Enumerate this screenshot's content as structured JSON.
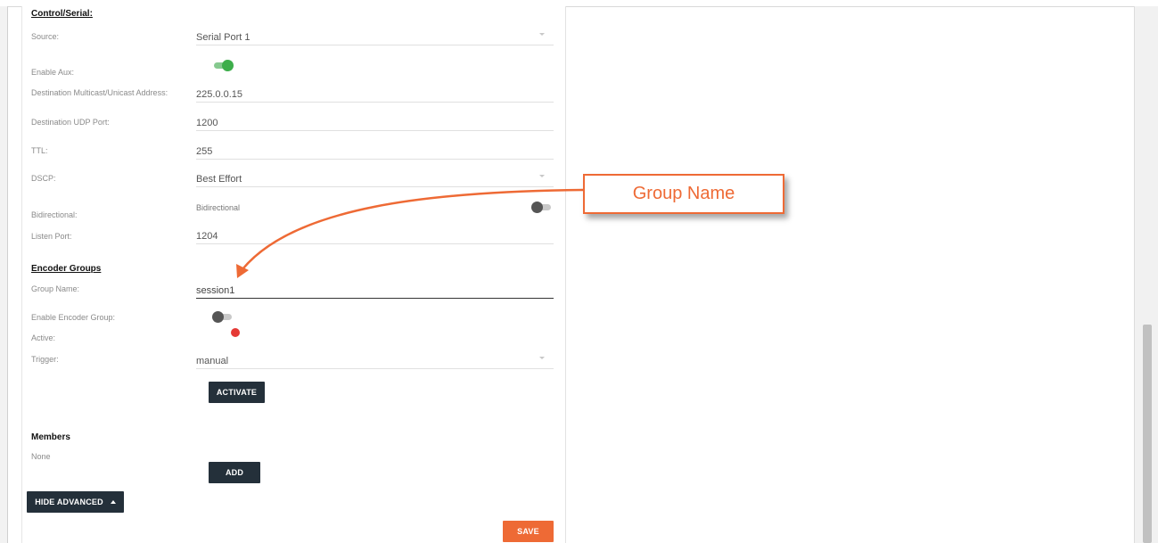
{
  "control_serial": {
    "title": "Control/Serial:",
    "source": {
      "label": "Source:",
      "value": "Serial Port 1"
    },
    "enable_aux": {
      "label": "Enable Aux:",
      "on": true
    },
    "destination_address": {
      "label": "Destination Multicast/Unicast Address:",
      "value": "225.0.0.15"
    },
    "destination_port": {
      "label": "Destination UDP Port:",
      "value": "1200"
    },
    "ttl": {
      "label": "TTL:",
      "value": "255"
    },
    "dscp": {
      "label": "DSCP:",
      "value": "Best Effort"
    },
    "bidirectional": {
      "label": "Bidirectional:",
      "toggle_label": "Bidirectional",
      "on": false
    },
    "listen_port": {
      "label": "Listen Port:",
      "value": "1204"
    }
  },
  "encoder_groups": {
    "title": "Encoder Groups",
    "group_name": {
      "label": "Group Name:",
      "value": "session1"
    },
    "enable_encoder_group": {
      "label": "Enable Encoder Group:",
      "on": false
    },
    "active": {
      "label": "Active:",
      "status_color": "#e53935"
    },
    "trigger": {
      "label": "Trigger:",
      "value": "manual"
    },
    "activate_label": "ACTIVATE"
  },
  "members": {
    "title": "Members",
    "value": "None",
    "add_label": "ADD"
  },
  "hide_advanced_label": "HIDE ADVANCED",
  "save_label": "SAVE",
  "annotation": {
    "text": "Group Name",
    "color": "#ee6a35"
  }
}
